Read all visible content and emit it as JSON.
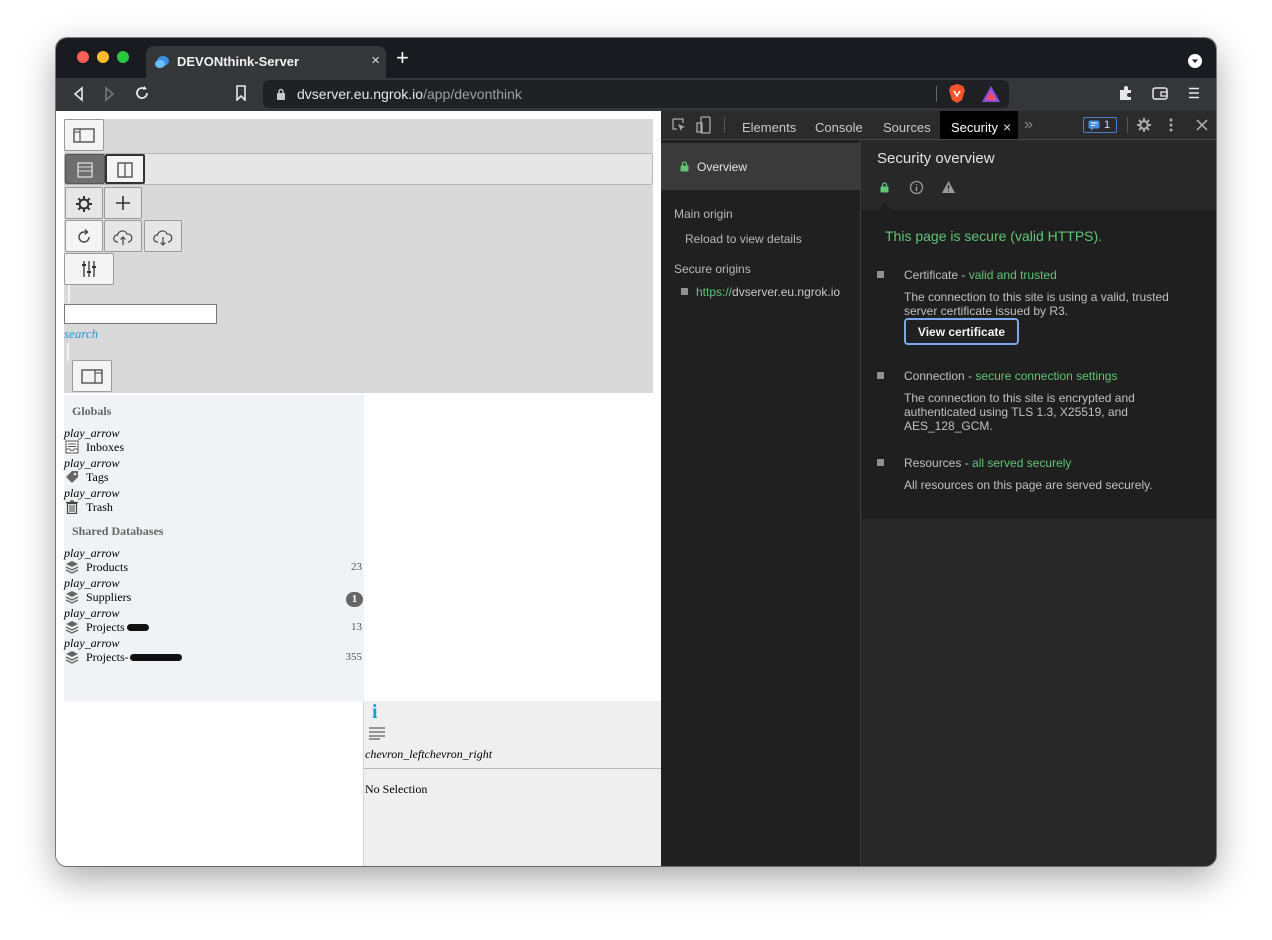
{
  "browser": {
    "tab_title": "DEVONthink-Server",
    "tab_close": "×",
    "new_tab": "+",
    "url_host": "dvserver.eu.ngrok.io",
    "url_path": "/app/devonthink"
  },
  "app": {
    "search_label": "search",
    "search_value": "",
    "sidebar": {
      "globals_header": "Globals",
      "globals": [
        {
          "arrow": "play_arrow",
          "label": "Inboxes",
          "icon": "inbox-icon"
        },
        {
          "arrow": "play_arrow",
          "label": "Tags",
          "icon": "tag-icon"
        },
        {
          "arrow": "play_arrow",
          "label": "Trash",
          "icon": "trash-icon"
        }
      ],
      "shared_header": "Shared Databases",
      "databases": [
        {
          "arrow": "play_arrow",
          "label": "Products",
          "count": "23"
        },
        {
          "arrow": "play_arrow",
          "label": "Suppliers",
          "badge": "1"
        },
        {
          "arrow": "play_arrow",
          "label": "Projects",
          "count": "13"
        },
        {
          "arrow": "play_arrow",
          "label": "Projects-",
          "count": "355"
        }
      ]
    },
    "info": {
      "info_glyph": "i",
      "chevrons": "chevron_leftchevron_right",
      "no_selection": "No Selection"
    }
  },
  "devtools": {
    "tabs": [
      "Elements",
      "Console",
      "Sources",
      "Security"
    ],
    "active_tab": "Security",
    "active_tab_close": "×",
    "more": "»",
    "issues_count": "1",
    "nav": {
      "overview": "Overview",
      "main_origin": "Main origin",
      "reload_hint": "Reload to view details",
      "secure_origins": "Secure origins",
      "origin_scheme": "https://",
      "origin_host": "dvserver.eu.ngrok.io"
    },
    "overview": {
      "title": "Security overview",
      "summary": "This page is secure (valid HTTPS).",
      "certificate": {
        "title": "Certificate",
        "sep": " - ",
        "status": "valid and trusted",
        "description": "The connection to this site is using a valid, trusted server certificate issued by R3.",
        "button": "View certificate"
      },
      "connection": {
        "title": "Connection",
        "sep": " - ",
        "status": "secure connection settings",
        "description": "The connection to this site is encrypted and authenticated using TLS 1.3, X25519, and AES_128_GCM."
      },
      "resources": {
        "title": "Resources",
        "sep": " - ",
        "status": "all served securely",
        "description": "All resources on this page are served securely."
      }
    },
    "colors": {
      "secure_green": "#5fc575",
      "panel_bg": "#282828",
      "sidebar_bg": "#202020"
    }
  }
}
